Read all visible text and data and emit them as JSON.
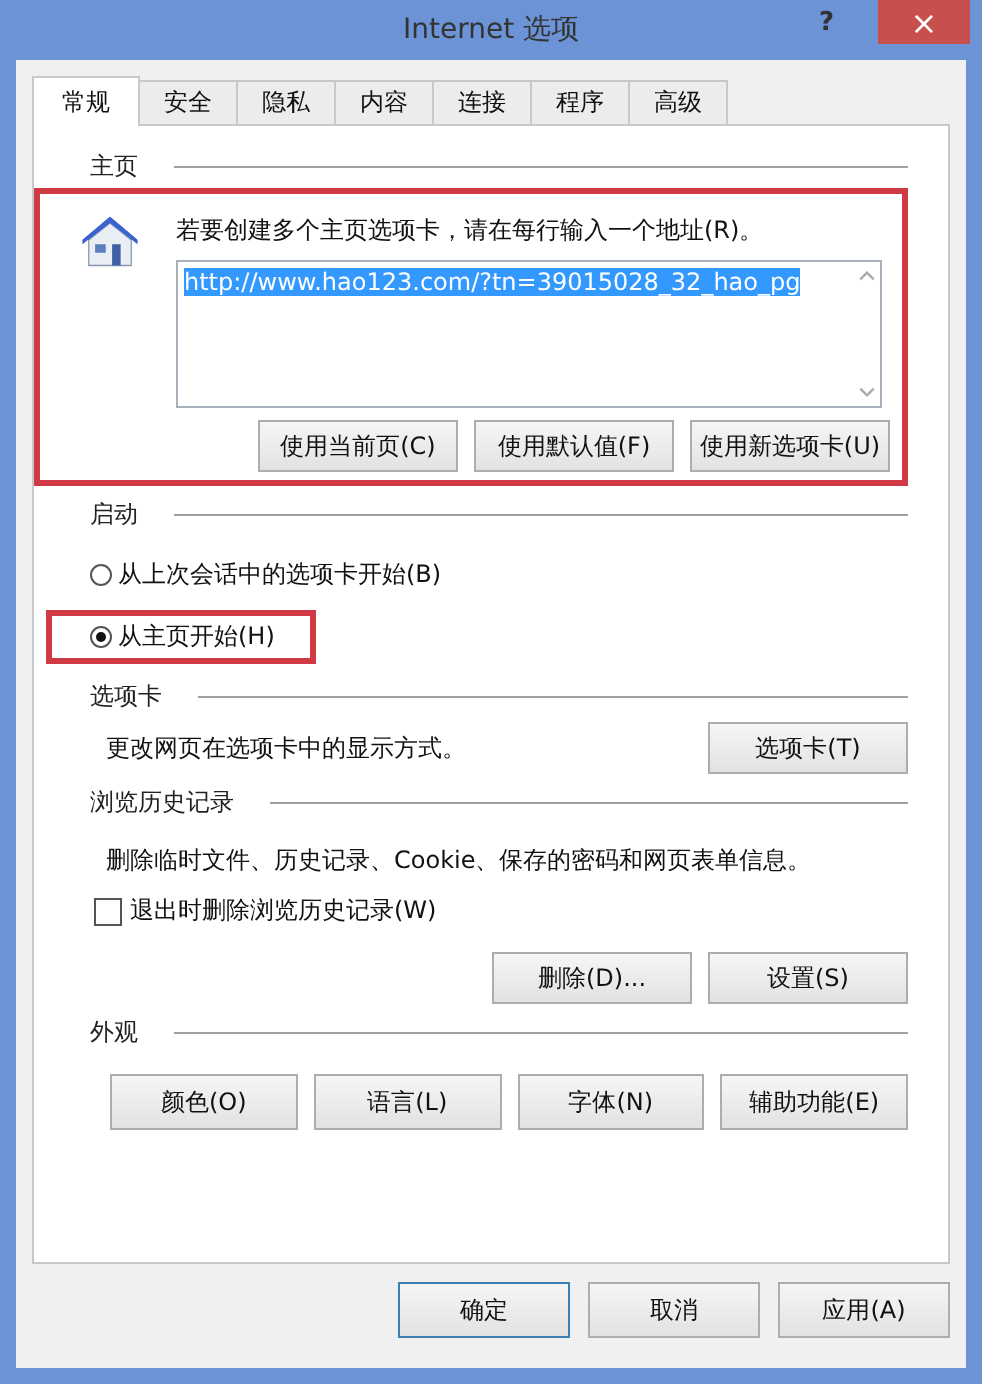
{
  "window": {
    "title": "Internet 选项",
    "help": "?",
    "close": "×"
  },
  "tabs": [
    {
      "label": "常规",
      "selected": true
    },
    {
      "label": "安全",
      "selected": false
    },
    {
      "label": "隐私",
      "selected": false
    },
    {
      "label": "内容",
      "selected": false
    },
    {
      "label": "连接",
      "selected": false
    },
    {
      "label": "程序",
      "selected": false
    },
    {
      "label": "高级",
      "selected": false
    }
  ],
  "homepage": {
    "heading": "主页",
    "highlighted": true,
    "instruction": "若要创建多个主页选项卡，请在每行输入一个地址(R)。",
    "value": "http://www.hao123.com/?tn=39015028_32_hao_pg",
    "buttons": [
      "使用当前页(C)",
      "使用默认值(F)",
      "使用新选项卡(U)"
    ]
  },
  "startup": {
    "heading": "启动",
    "options": [
      {
        "label": "从上次会话中的选项卡开始(B)",
        "selected": false,
        "highlighted": false
      },
      {
        "label": "从主页开始(H)",
        "selected": true,
        "highlighted": true
      }
    ]
  },
  "tabs_section": {
    "heading": "选项卡",
    "description": "更改网页在选项卡中的显示方式。",
    "button": "选项卡(T)"
  },
  "history": {
    "heading": "浏览历史记录",
    "description": "删除临时文件、历史记录、Cookie、保存的密码和网页表单信息。",
    "checkbox": {
      "label": "退出时删除浏览历史记录(W)",
      "checked": false
    },
    "buttons": [
      "删除(D)...",
      "设置(S)"
    ]
  },
  "appearance": {
    "heading": "外观",
    "buttons": [
      "颜色(O)",
      "语言(L)",
      "字体(N)",
      "辅助功能(E)"
    ]
  },
  "footer_buttons": [
    {
      "label": "确定",
      "default": true
    },
    {
      "label": "取消",
      "default": false
    },
    {
      "label": "应用(A)",
      "default": false
    }
  ]
}
